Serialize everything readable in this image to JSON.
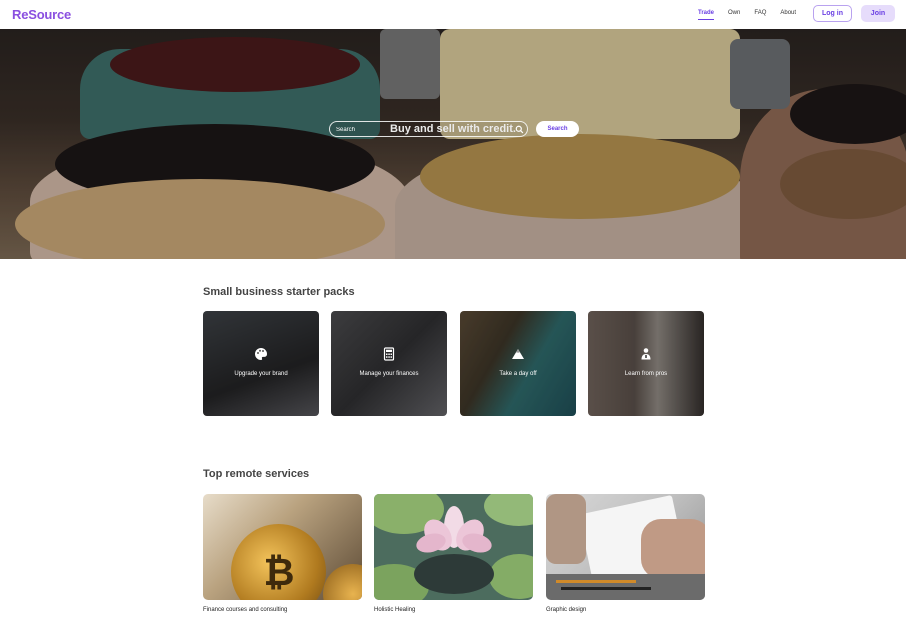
{
  "brand": {
    "logo_text": "ReSource",
    "accent": "#6a3fe3"
  },
  "nav": {
    "links": [
      {
        "label": "Trade",
        "active": true
      },
      {
        "label": "Own",
        "active": false
      },
      {
        "label": "FAQ",
        "active": false
      },
      {
        "label": "About",
        "active": false
      }
    ],
    "login_label": "Log in",
    "join_label": "Join"
  },
  "hero": {
    "title": "Buy and sell with credit.",
    "search_placeholder": "Search",
    "search_button": "Search"
  },
  "starter_packs": {
    "title": "Small business starter packs",
    "items": [
      {
        "label": "Upgrade your brand",
        "icon": "palette-icon"
      },
      {
        "label": "Manage your finances",
        "icon": "calculator-icon"
      },
      {
        "label": "Take a day off",
        "icon": "mountain-icon"
      },
      {
        "label": "Learn from pros",
        "icon": "presenter-icon"
      }
    ]
  },
  "remote_services": {
    "title": "Top remote services",
    "items": [
      {
        "label": "Finance courses and consulting"
      },
      {
        "label": "Holistic Healing"
      },
      {
        "label": "Graphic design"
      }
    ]
  }
}
